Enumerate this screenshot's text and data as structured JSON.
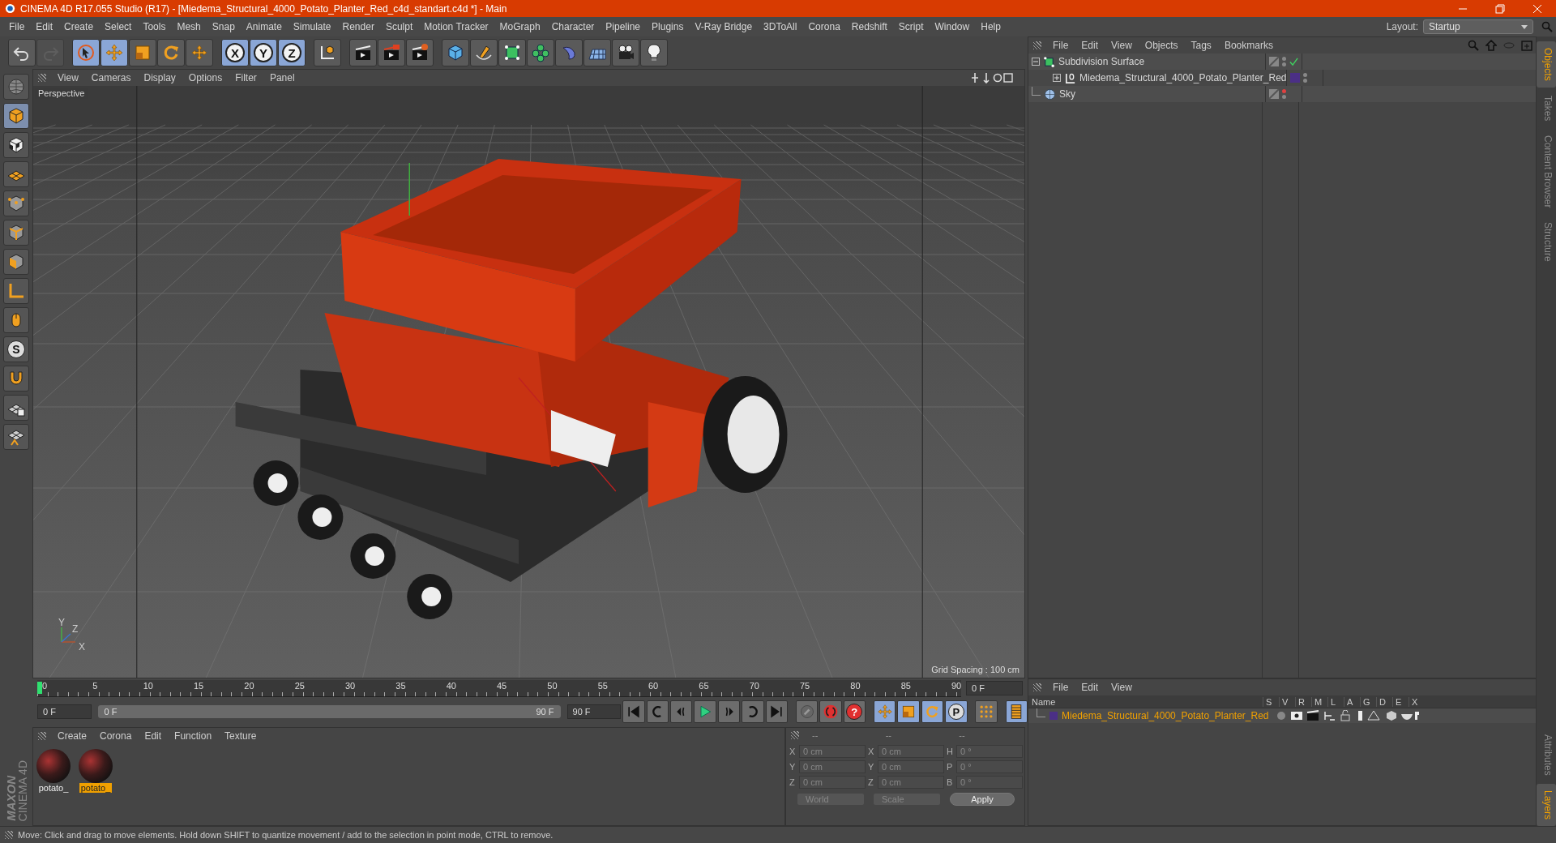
{
  "window": {
    "title": "CINEMA 4D R17.055 Studio (R17) - [Miedema_Structural_4000_Potato_Planter_Red_c4d_standart.c4d *] - Main"
  },
  "menu": [
    "File",
    "Edit",
    "Create",
    "Select",
    "Tools",
    "Mesh",
    "Snap",
    "Animate",
    "Simulate",
    "Render",
    "Sculpt",
    "Motion Tracker",
    "MoGraph",
    "Character",
    "Pipeline",
    "Plugins",
    "V-Ray Bridge",
    "3DToAll",
    "Corona",
    "Redshift",
    "Script",
    "Window",
    "Help"
  ],
  "layout": {
    "label": "Layout:",
    "value": "Startup"
  },
  "toolbar": [
    {
      "kind": "undo",
      "selected": false,
      "disabled": false
    },
    {
      "kind": "redo",
      "selected": false,
      "disabled": true
    },
    {
      "kind": "select",
      "selected": true,
      "disabled": false
    },
    {
      "kind": "move",
      "selected": true,
      "disabled": false
    },
    {
      "kind": "scale",
      "selected": false,
      "disabled": false
    },
    {
      "kind": "rotate",
      "selected": false,
      "disabled": false
    },
    {
      "kind": "multi",
      "selected": false,
      "disabled": false
    },
    {
      "kind": "axis",
      "label": "X",
      "selected": true,
      "disabled": false
    },
    {
      "kind": "axis",
      "label": "Y",
      "selected": true,
      "disabled": false
    },
    {
      "kind": "axis",
      "label": "Z",
      "selected": true,
      "disabled": false
    },
    {
      "kind": "coord",
      "selected": false,
      "disabled": false
    },
    {
      "kind": "render",
      "selected": false,
      "disabled": false
    },
    {
      "kind": "render2",
      "selected": false,
      "disabled": false
    },
    {
      "kind": "render3",
      "selected": false,
      "disabled": false
    },
    {
      "kind": "cube",
      "selected": false,
      "disabled": false
    },
    {
      "kind": "pen",
      "selected": false,
      "disabled": false
    },
    {
      "kind": "subdiv",
      "selected": false,
      "disabled": false
    },
    {
      "kind": "cloner",
      "selected": false,
      "disabled": false
    },
    {
      "kind": "deformer",
      "selected": false,
      "disabled": false
    },
    {
      "kind": "floor",
      "selected": false,
      "disabled": false
    },
    {
      "kind": "camera",
      "selected": false,
      "disabled": false
    },
    {
      "kind": "light",
      "selected": false,
      "disabled": false
    }
  ],
  "tools": [
    {
      "kind": "sphere",
      "selected": false
    },
    {
      "kind": "model",
      "selected": true
    },
    {
      "kind": "texture",
      "selected": false
    },
    {
      "kind": "workplane",
      "selected": false
    },
    {
      "kind": "points",
      "selected": false
    },
    {
      "kind": "edges",
      "selected": false
    },
    {
      "kind": "polygons",
      "selected": false
    },
    {
      "kind": "axisl",
      "selected": false
    },
    {
      "kind": "tweak",
      "selected": false
    },
    {
      "kind": "snap",
      "label": "S",
      "selected": false
    },
    {
      "kind": "magnet",
      "selected": false
    },
    {
      "kind": "gridlock",
      "selected": false
    },
    {
      "kind": "gridsnap",
      "selected": false
    }
  ],
  "viewport": {
    "menu": [
      "View",
      "Cameras",
      "Display",
      "Options",
      "Filter",
      "Panel"
    ],
    "camera": "Perspective",
    "grid_spacing": "Grid Spacing : 100 cm",
    "axis_labels": [
      "Y",
      "Z",
      "X"
    ]
  },
  "timeline": {
    "range": {
      "level": 1
    },
    "ticks": [
      "0",
      "5",
      "10",
      "15",
      "20",
      "25",
      "30",
      "35",
      "40",
      "45",
      "50",
      "55",
      "60",
      "65",
      "70",
      "75",
      "80",
      "85",
      "90"
    ],
    "level": 0,
    "frame": "0 F",
    "start": "0 F",
    "range_start": "0 F",
    "range_end": "90 F",
    "end": "90 F"
  },
  "transport": [
    {
      "kind": "first",
      "selected": false
    },
    {
      "kind": "loopback",
      "selected": false
    },
    {
      "kind": "prevkey",
      "selected": false
    },
    {
      "kind": "play",
      "selected": false
    },
    {
      "kind": "nextkey",
      "selected": false
    },
    {
      "kind": "loopfwd",
      "selected": false
    },
    {
      "kind": "last",
      "selected": false
    },
    {
      "kind": "key",
      "selected": false
    },
    {
      "kind": "record",
      "selected": false
    },
    {
      "kind": "help",
      "label": "?",
      "selected": false
    },
    {
      "kind": "move",
      "selected": true
    },
    {
      "kind": "scale",
      "selected": true
    },
    {
      "kind": "rotate",
      "selected": true
    },
    {
      "kind": "param",
      "label": "P",
      "selected": true
    },
    {
      "kind": "dots",
      "selected": false
    },
    {
      "kind": "film",
      "selected": true
    }
  ],
  "materials": {
    "menu": [
      "Create",
      "Corona",
      "Edit",
      "Function",
      "Texture"
    ],
    "items": [
      {
        "name": "potato_",
        "selected": false
      },
      {
        "name": "potato_",
        "selected": true
      }
    ]
  },
  "brand": [
    "MAXON",
    "CINEMA 4D"
  ],
  "coordinates": {
    "headers": [
      "--",
      "--",
      "--"
    ],
    "rows": [
      {
        "axis": "X",
        "position": "0 cm",
        "size_axis": "X",
        "size": "0 cm",
        "rot_axis": "H",
        "rotation": "0 °"
      },
      {
        "axis": "Y",
        "position": "0 cm",
        "size_axis": "Y",
        "size": "0 cm",
        "rot_axis": "P",
        "rotation": "0 °"
      },
      {
        "axis": "Z",
        "position": "0 cm",
        "size_axis": "Z",
        "size": "0 cm",
        "rot_axis": "B",
        "rotation": "0 °"
      }
    ],
    "mode": "World",
    "size_mode": "Scale",
    "apply": "Apply"
  },
  "objects": {
    "menu": [
      "File",
      "Edit",
      "View",
      "Objects",
      "Tags",
      "Bookmarks"
    ],
    "tree": [
      {
        "name": "Subdivision Surface",
        "kind": "subdivision",
        "tag": {
          "kind": "display"
        },
        "checked": true,
        "render_off": false,
        "expanded": true,
        "children": [
          {
            "name": "Miedema_Structural_4000_Potato_Planter_Red",
            "kind": "null",
            "tag": {
              "kind": "layer"
            },
            "color": "#4b2f86",
            "checked": false,
            "render_off": false,
            "expanded": false
          }
        ]
      },
      {
        "name": "Sky",
        "kind": "sky",
        "tag": {
          "kind": "display"
        },
        "checked": false,
        "render_off": true
      }
    ]
  },
  "side_tabs": [
    {
      "label": "Objects",
      "selected": true
    },
    {
      "label": "Takes",
      "selected": false
    },
    {
      "label": "Content Browser",
      "selected": false
    },
    {
      "label": "Structure",
      "selected": false
    }
  ],
  "side_tabs_lower": [
    {
      "label": "Attributes",
      "selected": false
    },
    {
      "label": "Layers",
      "selected": true
    }
  ],
  "layers": {
    "menu": [
      "File",
      "Edit",
      "View"
    ],
    "columns": [
      "Name",
      "S",
      "V",
      "R",
      "M",
      "L",
      "A",
      "G",
      "D",
      "E",
      "X"
    ],
    "rows": [
      {
        "name": "Miedema_Structural_4000_Potato_Planter_Red",
        "color": "#4b2f86"
      }
    ]
  },
  "status": "Move: Click and drag to move elements. Hold down SHIFT to quantize movement / add to the selection in point mode, CTRL to remove."
}
